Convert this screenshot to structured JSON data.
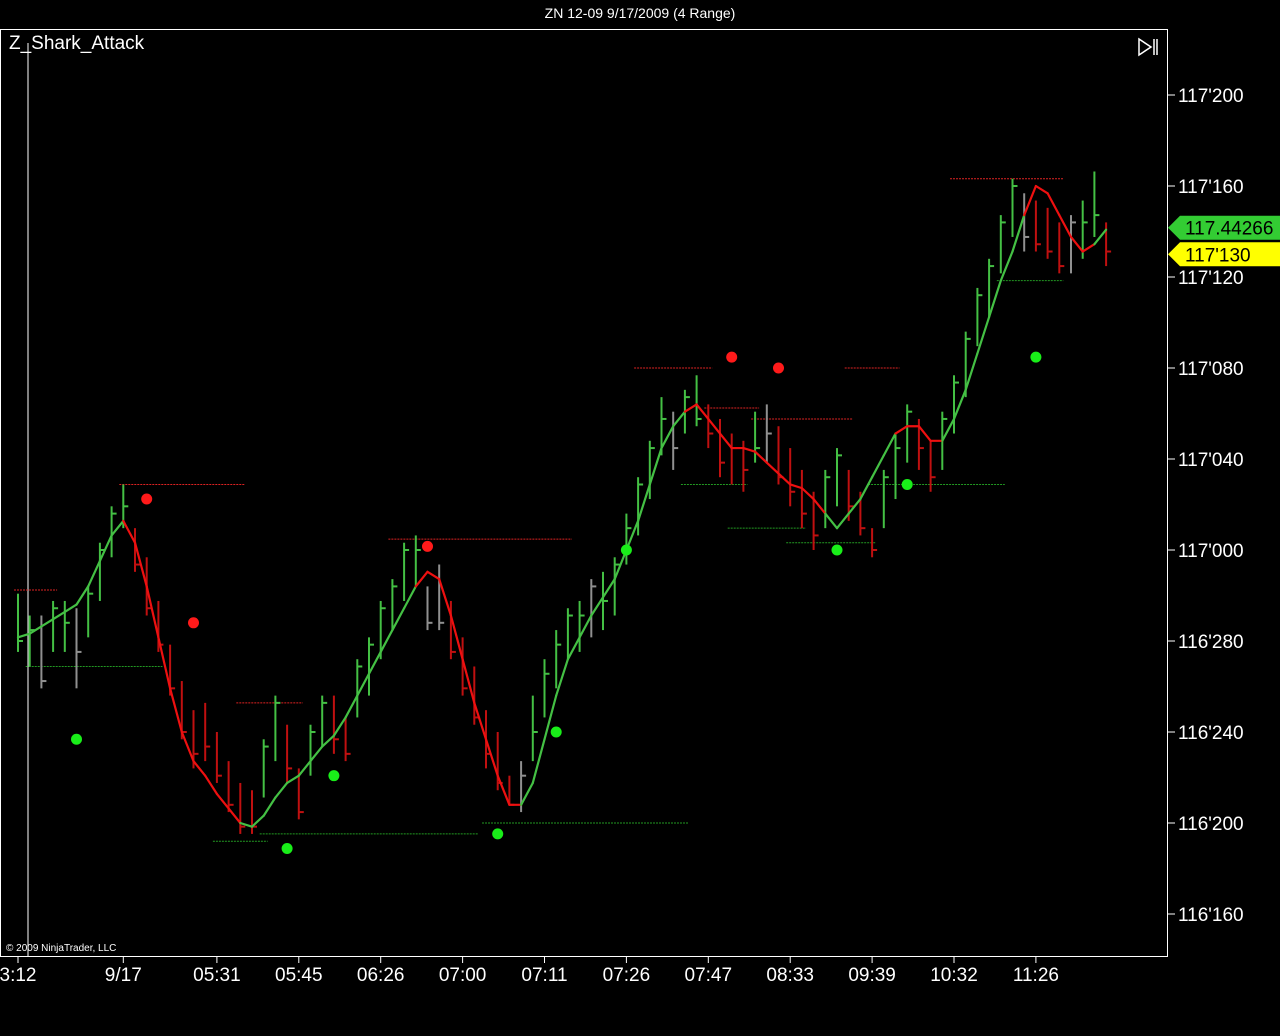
{
  "window": {
    "title": "ZN 12-09  9/17/2009 (4 Range)",
    "indicator": "Z_Shark_Attack",
    "copyright": "© 2009 NinjaTrader, LLC"
  },
  "colors": {
    "background": "#000000",
    "up_bar": "#44c044",
    "down_bar": "#c01010",
    "neutral_bar": "#909090",
    "ma_up": "#44c044",
    "ma_down": "#ee1010",
    "dot_red": "#ff1a1a",
    "dot_green": "#19ee19",
    "level_red": "#dd2222",
    "level_green": "#229922",
    "price_marker_green": "#33cc33",
    "price_marker_yellow": "#ffff00"
  },
  "chart_data": {
    "type": "ohlc",
    "y_tick_labels": [
      "117'200",
      "117'160",
      "117'120",
      "117'080",
      "117'040",
      "117'000",
      "116'280",
      "116'240",
      "116'200",
      "116'160"
    ],
    "y_tick_values": [
      117.625,
      117.5,
      117.375,
      117.25,
      117.125,
      117.0,
      116.875,
      116.75,
      116.625,
      116.5
    ],
    "ylim": [
      116.3125,
      117.8125
    ],
    "x_tick_labels": [
      "3:12",
      "9/17",
      "05:31",
      "05:45",
      "06:26",
      "07:00",
      "07:11",
      "07:26",
      "07:47",
      "08:33",
      "09:39",
      "10:32",
      "11:26"
    ],
    "x_tick_bar_index": [
      0,
      9,
      17,
      24,
      31,
      38,
      45,
      52,
      59,
      66,
      73,
      80,
      87
    ],
    "current_price_markers": [
      {
        "label": "117.44266",
        "value": 117.4427,
        "color": "green"
      },
      {
        "label": "117'130",
        "value": 117.40625,
        "color": "yellow"
      }
    ],
    "bars": [
      {
        "h": 116.94,
        "l": 116.86,
        "c": 116.875,
        "s": "up"
      },
      {
        "h": 116.91,
        "l": 116.84,
        "c": 116.89,
        "s": "up"
      },
      {
        "h": 116.91,
        "l": 116.81,
        "c": 116.82,
        "s": "neutral"
      },
      {
        "h": 116.93,
        "l": 116.86,
        "c": 116.92,
        "s": "up"
      },
      {
        "h": 116.93,
        "l": 116.86,
        "c": 116.9,
        "s": "up"
      },
      {
        "h": 116.92,
        "l": 116.81,
        "c": 116.86,
        "s": "neutral"
      },
      {
        "h": 116.95,
        "l": 116.88,
        "c": 116.94,
        "s": "up"
      },
      {
        "h": 117.01,
        "l": 116.93,
        "c": 117.0,
        "s": "up"
      },
      {
        "h": 117.06,
        "l": 116.99,
        "c": 117.05,
        "s": "up"
      },
      {
        "h": 117.09,
        "l": 117.03,
        "c": 117.06,
        "s": "up"
      },
      {
        "h": 117.03,
        "l": 116.97,
        "c": 116.98,
        "s": "down"
      },
      {
        "h": 116.99,
        "l": 116.91,
        "c": 116.92,
        "s": "down"
      },
      {
        "h": 116.93,
        "l": 116.86,
        "c": 116.87,
        "s": "down"
      },
      {
        "h": 116.87,
        "l": 116.8,
        "c": 116.81,
        "s": "down"
      },
      {
        "h": 116.82,
        "l": 116.74,
        "c": 116.75,
        "s": "down"
      },
      {
        "h": 116.78,
        "l": 116.7,
        "c": 116.72,
        "s": "down"
      },
      {
        "h": 116.79,
        "l": 116.71,
        "c": 116.73,
        "s": "down"
      },
      {
        "h": 116.75,
        "l": 116.68,
        "c": 116.69,
        "s": "down"
      },
      {
        "h": 116.71,
        "l": 116.64,
        "c": 116.65,
        "s": "down"
      },
      {
        "h": 116.68,
        "l": 116.61,
        "c": 116.62,
        "s": "down"
      },
      {
        "h": 116.67,
        "l": 116.61,
        "c": 116.62,
        "s": "down"
      },
      {
        "h": 116.74,
        "l": 116.66,
        "c": 116.73,
        "s": "up"
      },
      {
        "h": 116.8,
        "l": 116.71,
        "c": 116.79,
        "s": "up"
      },
      {
        "h": 116.76,
        "l": 116.68,
        "c": 116.7,
        "s": "down"
      },
      {
        "h": 116.7,
        "l": 116.63,
        "c": 116.64,
        "s": "down"
      },
      {
        "h": 116.76,
        "l": 116.69,
        "c": 116.75,
        "s": "up"
      },
      {
        "h": 116.8,
        "l": 116.73,
        "c": 116.79,
        "s": "up"
      },
      {
        "h": 116.8,
        "l": 116.72,
        "c": 116.74,
        "s": "down"
      },
      {
        "h": 116.77,
        "l": 116.71,
        "c": 116.72,
        "s": "down"
      },
      {
        "h": 116.85,
        "l": 116.77,
        "c": 116.84,
        "s": "up"
      },
      {
        "h": 116.88,
        "l": 116.8,
        "c": 116.87,
        "s": "up"
      },
      {
        "h": 116.93,
        "l": 116.85,
        "c": 116.92,
        "s": "up"
      },
      {
        "h": 116.96,
        "l": 116.89,
        "c": 116.95,
        "s": "up"
      },
      {
        "h": 117.01,
        "l": 116.93,
        "c": 117.0,
        "s": "up"
      },
      {
        "h": 117.02,
        "l": 116.95,
        "c": 117.0,
        "s": "up"
      },
      {
        "h": 116.95,
        "l": 116.89,
        "c": 116.9,
        "s": "neutral"
      },
      {
        "h": 116.98,
        "l": 116.89,
        "c": 116.9,
        "s": "neutral"
      },
      {
        "h": 116.93,
        "l": 116.85,
        "c": 116.86,
        "s": "down"
      },
      {
        "h": 116.88,
        "l": 116.8,
        "c": 116.81,
        "s": "down"
      },
      {
        "h": 116.84,
        "l": 116.76,
        "c": 116.77,
        "s": "down"
      },
      {
        "h": 116.78,
        "l": 116.7,
        "c": 116.72,
        "s": "down"
      },
      {
        "h": 116.75,
        "l": 116.67,
        "c": 116.68,
        "s": "down"
      },
      {
        "h": 116.69,
        "l": 116.65,
        "c": 116.65,
        "s": "down"
      },
      {
        "h": 116.71,
        "l": 116.64,
        "c": 116.69,
        "s": "neutral"
      },
      {
        "h": 116.8,
        "l": 116.71,
        "c": 116.75,
        "s": "up"
      },
      {
        "h": 116.85,
        "l": 116.77,
        "c": 116.83,
        "s": "up"
      },
      {
        "h": 116.89,
        "l": 116.81,
        "c": 116.87,
        "s": "up"
      },
      {
        "h": 116.92,
        "l": 116.85,
        "c": 116.91,
        "s": "up"
      },
      {
        "h": 116.93,
        "l": 116.86,
        "c": 116.91,
        "s": "up"
      },
      {
        "h": 116.96,
        "l": 116.88,
        "c": 116.95,
        "s": "neutral"
      },
      {
        "h": 116.97,
        "l": 116.89,
        "c": 116.93,
        "s": "up"
      },
      {
        "h": 116.99,
        "l": 116.91,
        "c": 116.98,
        "s": "up"
      },
      {
        "h": 117.05,
        "l": 116.98,
        "c": 117.03,
        "s": "up"
      },
      {
        "h": 117.1,
        "l": 117.02,
        "c": 117.09,
        "s": "up"
      },
      {
        "h": 117.15,
        "l": 117.07,
        "c": 117.14,
        "s": "up"
      },
      {
        "h": 117.21,
        "l": 117.13,
        "c": 117.18,
        "s": "up"
      },
      {
        "h": 117.19,
        "l": 117.11,
        "c": 117.14,
        "s": "neutral"
      },
      {
        "h": 117.22,
        "l": 117.16,
        "c": 117.21,
        "s": "up"
      },
      {
        "h": 117.24,
        "l": 117.17,
        "c": 117.18,
        "s": "up"
      },
      {
        "h": 117.2,
        "l": 117.14,
        "c": 117.16,
        "s": "down"
      },
      {
        "h": 117.18,
        "l": 117.1,
        "c": 117.12,
        "s": "down"
      },
      {
        "h": 117.16,
        "l": 117.09,
        "c": 117.14,
        "s": "down"
      },
      {
        "h": 117.15,
        "l": 117.08,
        "c": 117.11,
        "s": "down"
      },
      {
        "h": 117.19,
        "l": 117.12,
        "c": 117.14,
        "s": "up"
      },
      {
        "h": 117.2,
        "l": 117.12,
        "c": 117.16,
        "s": "neutral"
      },
      {
        "h": 117.17,
        "l": 117.09,
        "c": 117.1,
        "s": "down"
      },
      {
        "h": 117.14,
        "l": 117.06,
        "c": 117.08,
        "s": "down"
      },
      {
        "h": 117.11,
        "l": 117.03,
        "c": 117.05,
        "s": "down"
      },
      {
        "h": 117.08,
        "l": 117.0,
        "c": 117.02,
        "s": "down"
      },
      {
        "h": 117.11,
        "l": 117.03,
        "c": 117.1,
        "s": "up"
      },
      {
        "h": 117.14,
        "l": 117.06,
        "c": 117.13,
        "s": "up"
      },
      {
        "h": 117.11,
        "l": 117.04,
        "c": 117.06,
        "s": "down"
      },
      {
        "h": 117.08,
        "l": 117.02,
        "c": 117.03,
        "s": "down"
      },
      {
        "h": 117.03,
        "l": 116.99,
        "c": 117.0,
        "s": "down"
      },
      {
        "h": 117.11,
        "l": 117.03,
        "c": 117.1,
        "s": "up"
      },
      {
        "h": 117.16,
        "l": 117.07,
        "c": 117.14,
        "s": "up"
      },
      {
        "h": 117.2,
        "l": 117.12,
        "c": 117.19,
        "s": "up"
      },
      {
        "h": 117.18,
        "l": 117.11,
        "c": 117.14,
        "s": "down"
      },
      {
        "h": 117.15,
        "l": 117.08,
        "c": 117.1,
        "s": "down"
      },
      {
        "h": 117.19,
        "l": 117.11,
        "c": 117.18,
        "s": "up"
      },
      {
        "h": 117.24,
        "l": 117.16,
        "c": 117.23,
        "s": "up"
      },
      {
        "h": 117.3,
        "l": 117.21,
        "c": 117.29,
        "s": "up"
      },
      {
        "h": 117.36,
        "l": 117.28,
        "c": 117.35,
        "s": "up"
      },
      {
        "h": 117.4,
        "l": 117.32,
        "c": 117.39,
        "s": "up"
      },
      {
        "h": 117.46,
        "l": 117.38,
        "c": 117.45,
        "s": "up"
      },
      {
        "h": 117.51,
        "l": 117.43,
        "c": 117.5,
        "s": "up"
      },
      {
        "h": 117.49,
        "l": 117.41,
        "c": 117.43,
        "s": "neutral"
      },
      {
        "h": 117.48,
        "l": 117.41,
        "c": 117.42,
        "s": "down"
      },
      {
        "h": 117.47,
        "l": 117.4,
        "c": 117.41,
        "s": "down"
      },
      {
        "h": 117.45,
        "l": 117.38,
        "c": 117.39,
        "s": "down"
      },
      {
        "h": 117.46,
        "l": 117.38,
        "c": 117.45,
        "s": "neutral"
      },
      {
        "h": 117.48,
        "l": 117.4,
        "c": 117.45,
        "s": "up"
      },
      {
        "h": 117.52,
        "l": 117.43,
        "c": 117.46,
        "s": "up"
      },
      {
        "h": 117.45,
        "l": 117.39,
        "c": 117.41,
        "s": "down"
      }
    ],
    "moving_average": [
      116.88,
      116.885,
      116.895,
      116.905,
      116.915,
      116.925,
      116.95,
      116.985,
      117.02,
      117.04,
      117.01,
      116.95,
      116.88,
      116.81,
      116.75,
      116.71,
      116.69,
      116.665,
      116.645,
      116.625,
      116.62,
      116.635,
      116.66,
      116.68,
      116.69,
      116.71,
      116.73,
      116.745,
      116.77,
      116.8,
      116.83,
      116.86,
      116.89,
      116.92,
      116.95,
      116.97,
      116.96,
      116.91,
      116.85,
      116.79,
      116.74,
      116.69,
      116.65,
      116.65,
      116.68,
      116.74,
      116.8,
      116.85,
      116.88,
      116.91,
      116.935,
      116.96,
      117.0,
      117.04,
      117.09,
      117.14,
      117.17,
      117.19,
      117.2,
      117.18,
      117.16,
      117.14,
      117.14,
      117.135,
      117.12,
      117.105,
      117.09,
      117.085,
      117.07,
      117.05,
      117.03,
      117.05,
      117.07,
      117.1,
      117.13,
      117.16,
      117.17,
      117.17,
      117.15,
      117.15,
      117.18,
      117.22,
      117.27,
      117.32,
      117.37,
      117.41,
      117.46,
      117.5,
      117.49,
      117.46,
      117.43,
      117.41,
      117.42,
      117.44
    ],
    "ma_segments_down": [
      [
        9,
        19
      ],
      [
        34,
        43
      ],
      [
        57,
        69
      ],
      [
        75,
        79
      ],
      [
        86,
        92
      ]
    ],
    "dots": [
      {
        "i": 5,
        "v": 116.74,
        "color": "green"
      },
      {
        "i": 11,
        "v": 117.07,
        "color": "red"
      },
      {
        "i": 15,
        "v": 116.9,
        "color": "red"
      },
      {
        "i": 23,
        "v": 116.59,
        "color": "green"
      },
      {
        "i": 27,
        "v": 116.69,
        "color": "green"
      },
      {
        "i": 35,
        "v": 117.005,
        "color": "red"
      },
      {
        "i": 41,
        "v": 116.61,
        "color": "green"
      },
      {
        "i": 46,
        "v": 116.75,
        "color": "green"
      },
      {
        "i": 52,
        "v": 117.0,
        "color": "green"
      },
      {
        "i": 61,
        "v": 117.265,
        "color": "red"
      },
      {
        "i": 65,
        "v": 117.25,
        "color": "red"
      },
      {
        "i": 70,
        "v": 117.0,
        "color": "green"
      },
      {
        "i": 76,
        "v": 117.09,
        "color": "green"
      },
      {
        "i": 87,
        "v": 117.265,
        "color": "green"
      }
    ],
    "levels": [
      {
        "v": 116.945,
        "from": 0,
        "to": 3,
        "color": "red"
      },
      {
        "v": 116.84,
        "from": 1,
        "to": 12,
        "color": "green"
      },
      {
        "v": 117.09,
        "from": 9,
        "to": 19,
        "color": "red"
      },
      {
        "v": 116.79,
        "from": 19,
        "to": 24,
        "color": "red"
      },
      {
        "v": 116.6,
        "from": 17,
        "to": 21,
        "color": "green"
      },
      {
        "v": 116.61,
        "from": 21,
        "to": 39,
        "color": "green"
      },
      {
        "v": 117.015,
        "from": 32,
        "to": 47,
        "color": "red"
      },
      {
        "v": 116.625,
        "from": 40,
        "to": 57,
        "color": "green"
      },
      {
        "v": 117.25,
        "from": 53,
        "to": 59,
        "color": "red"
      },
      {
        "v": 117.09,
        "from": 57,
        "to": 62,
        "color": "green"
      },
      {
        "v": 117.195,
        "from": 59,
        "to": 63,
        "color": "red"
      },
      {
        "v": 117.03,
        "from": 61,
        "to": 67,
        "color": "green"
      },
      {
        "v": 117.18,
        "from": 63,
        "to": 71,
        "color": "red"
      },
      {
        "v": 117.01,
        "from": 66,
        "to": 73,
        "color": "green"
      },
      {
        "v": 117.25,
        "from": 71,
        "to": 75,
        "color": "red"
      },
      {
        "v": 117.09,
        "from": 73,
        "to": 84,
        "color": "green"
      },
      {
        "v": 117.51,
        "from": 80,
        "to": 89,
        "color": "red"
      },
      {
        "v": 117.37,
        "from": 84,
        "to": 89,
        "color": "green"
      }
    ]
  }
}
